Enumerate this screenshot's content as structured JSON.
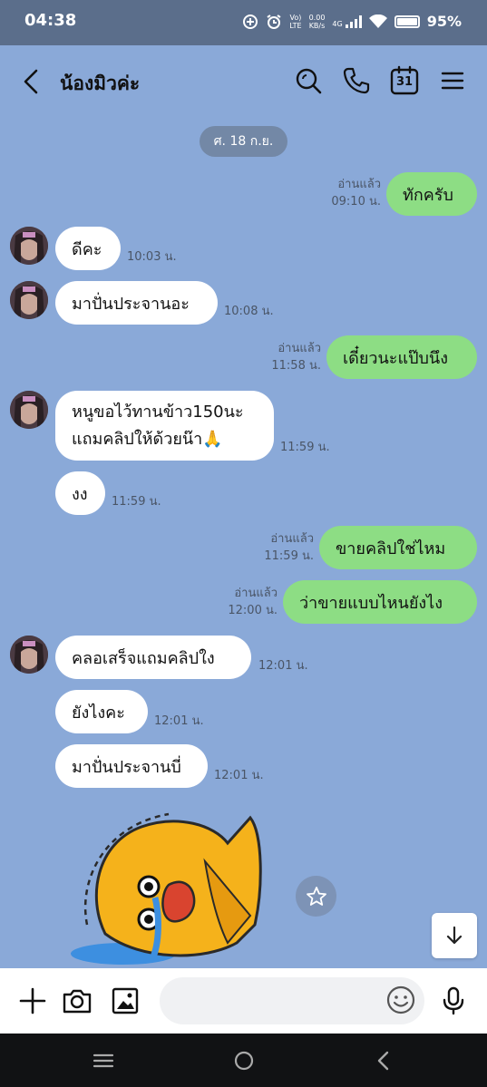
{
  "status_bar": {
    "time": "04:38",
    "network_speed_value": "0.00",
    "network_speed_unit": "KB/s",
    "volte": "Vo)",
    "lte": "LTE",
    "net_type": "4G",
    "battery": "95%"
  },
  "header": {
    "title": "น้องมิวค่ะ",
    "calendar_day": "31"
  },
  "date_pill": "ศ. 18 ก.ย.",
  "messages": [
    {
      "dir": "out",
      "text": "ทักครับ",
      "read": "อ่านแล้ว",
      "time": "09:10 น."
    },
    {
      "dir": "in",
      "text": "ดีคะ",
      "time": "10:03 น."
    },
    {
      "dir": "in",
      "text": "มาปั่นประจานอะ",
      "time": "10:08 น."
    },
    {
      "dir": "out",
      "text": "เดี๋ยวนะแป๊บนึง",
      "read": "อ่านแล้ว",
      "time": "11:58 น."
    },
    {
      "dir": "in",
      "text_line1": "หนูขอไว้ทานข้าว150นะ",
      "text_line2": "แถมคลิปให้ด้วยน๊า🙏",
      "time": "11:59 น."
    },
    {
      "dir": "in",
      "text": "งง",
      "time": "11:59 น."
    },
    {
      "dir": "out",
      "text": "ขายคลิปใช่ไหม",
      "read": "อ่านแล้ว",
      "time": "11:59 น."
    },
    {
      "dir": "out",
      "text": "ว่าขายแบบไหนยังไง",
      "read": "อ่านแล้ว",
      "time": "12:00 น."
    },
    {
      "dir": "in",
      "text": "คลอเสร็จแถมคลิปใง",
      "time": "12:01 น."
    },
    {
      "dir": "in",
      "text": "ยังไงคะ",
      "time": "12:01 น."
    },
    {
      "dir": "in",
      "text": "มาปั่นประจานบี่",
      "time": "12:01 น."
    }
  ],
  "input": {
    "placeholder": ""
  },
  "colors": {
    "chat_background": "#8aa9d8",
    "outgoing_bubble": "#8ddd84",
    "incoming_bubble": "#ffffff",
    "status_bar": "#5b6e8b"
  }
}
